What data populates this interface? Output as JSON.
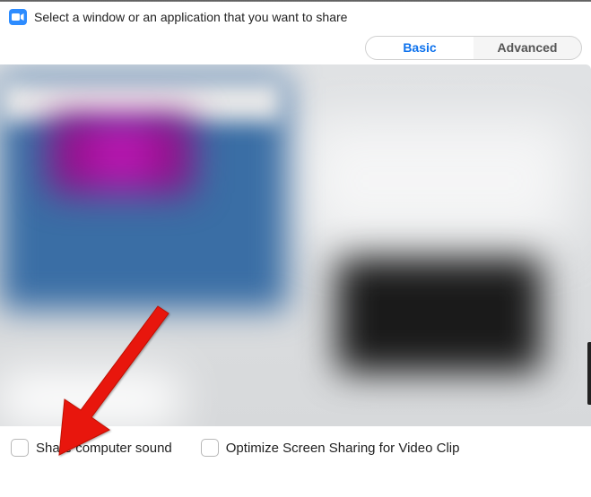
{
  "header": {
    "title": "Select a window or an application that you want to share"
  },
  "tabs": {
    "basic": "Basic",
    "advanced": "Advanced"
  },
  "footer": {
    "share_sound_label": "Share computer sound",
    "optimize_label": "Optimize Screen Sharing for Video Clip"
  }
}
